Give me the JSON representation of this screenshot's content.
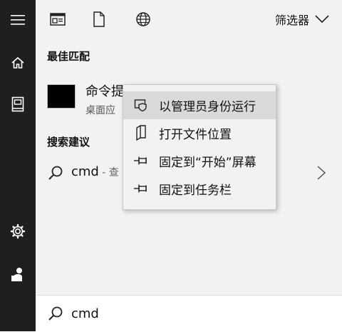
{
  "sidebar": {
    "icons": [
      "menu-icon",
      "home-icon",
      "documents-icon",
      "settings-icon",
      "user-icon"
    ]
  },
  "toolbar": {
    "icons": [
      "apps-icon",
      "documents-icon",
      "web-icon"
    ],
    "filter_label": "筛选器"
  },
  "results": {
    "best_match_title": "最佳匹配",
    "app_name": "命令提",
    "app_type": "桌面应",
    "suggestions_title": "搜索建议",
    "suggestion_query": "cmd",
    "suggestion_hint": " - 查"
  },
  "context_menu": {
    "items": [
      {
        "label": "以管理员身份运行",
        "icon": "shield-icon",
        "highlighted": true
      },
      {
        "label": "打开文件位置",
        "icon": "folder-icon",
        "highlighted": false
      },
      {
        "label": "固定到“开始”屏幕",
        "icon": "pin-icon",
        "highlighted": false
      },
      {
        "label": "固定到任务栏",
        "icon": "pin-icon",
        "highlighted": false
      }
    ]
  },
  "search": {
    "value": "cmd"
  },
  "colors": {
    "sidebar_bg": "#1f1f1f",
    "panel_bg": "#f2f2f2",
    "highlight": "#dadada"
  }
}
